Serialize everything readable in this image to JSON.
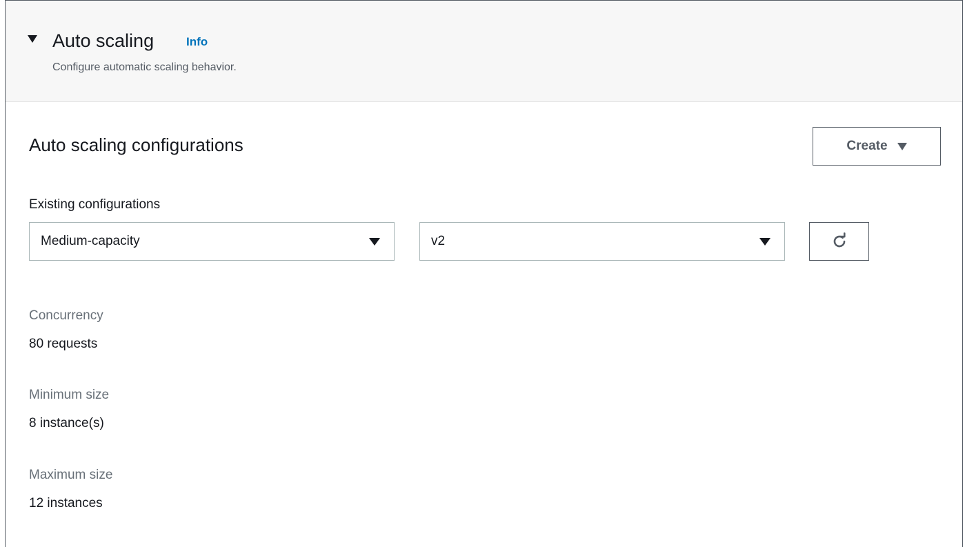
{
  "section": {
    "title": "Auto scaling",
    "info_link": "Info",
    "description": "Configure automatic scaling behavior."
  },
  "configurations": {
    "title": "Auto scaling configurations",
    "create_button": "Create",
    "existing_label": "Existing configurations",
    "config_select_value": "Medium-capacity",
    "version_select_value": "v2"
  },
  "details": {
    "concurrency_label": "Concurrency",
    "concurrency_value": "80 requests",
    "min_size_label": "Minimum size",
    "min_size_value": "8 instance(s)",
    "max_size_label": "Maximum size",
    "max_size_value": "12 instances"
  },
  "icons": {
    "collapse": "caret-down-icon",
    "dropdown": "caret-down-icon",
    "refresh": "refresh-icon"
  },
  "colors": {
    "link": "#0073bb",
    "header_bg": "#f7f7f7",
    "text": "#16191f",
    "muted_text": "#687078"
  }
}
